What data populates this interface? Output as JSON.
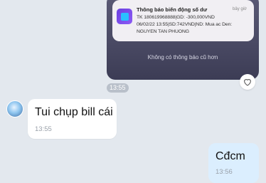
{
  "screenshot_message": {
    "notification": {
      "title": "Thông báo biến động số dư",
      "time": "bây giờ",
      "line1": "TK 180619968888|GD: -300,000VND",
      "line2": "06/02/22 13:55|SD:742VND|ND: Mua ac Den:",
      "line3": "NGUYEN TAN PHUONG"
    },
    "no_older_text": "Không có thông báo cũ hơn"
  },
  "react_icon": "heart-outline-icon",
  "screenshot_time": "13:55",
  "incoming": {
    "text": "Tui chụp bill cái",
    "time": "13:55"
  },
  "outgoing": {
    "text": "Cđcm",
    "time": "13:56"
  },
  "colors": {
    "background": "#e3e8ee",
    "outgoing_bubble": "#dbeefe",
    "incoming_bubble": "#ffffff"
  }
}
